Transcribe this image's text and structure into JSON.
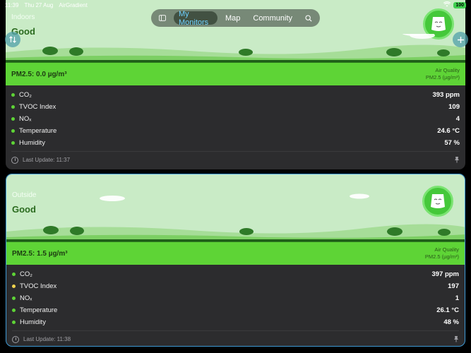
{
  "status": {
    "time": "11:39",
    "date": "Thu 27 Aug",
    "app": "AirGradient",
    "battery": "100"
  },
  "nav": {
    "items": [
      {
        "label": "My Monitors",
        "active": true
      },
      {
        "label": "Map"
      },
      {
        "label": "Community"
      }
    ]
  },
  "cards": [
    {
      "location": "Indoors",
      "quality": "Good",
      "pm": "PM2.5: 0.0 µg/m³",
      "aq_title": "Air Quality",
      "aq_unit": "PM2.5 (µg/m³)",
      "metrics": [
        {
          "name": "CO₂",
          "value": "393 ppm",
          "status": "green"
        },
        {
          "name": "TVOC Index",
          "value": "109",
          "status": "green"
        },
        {
          "name": "NOₓ",
          "value": "4",
          "status": "green"
        },
        {
          "name": "Temperature",
          "value": "24.6 °C",
          "status": "green"
        },
        {
          "name": "Humidity",
          "value": "57 %",
          "status": "green"
        }
      ],
      "last_update": "Last Update: 11:37"
    },
    {
      "location": "Outside",
      "quality": "Good",
      "pm": "PM2.5: 1.5 µg/m³",
      "aq_title": "Air Quality",
      "aq_unit": "PM2.5 (µg/m³)",
      "metrics": [
        {
          "name": "CO₂",
          "value": "397 ppm",
          "status": "green"
        },
        {
          "name": "TVOC Index",
          "value": "197",
          "status": "yellow"
        },
        {
          "name": "NOₓ",
          "value": "1",
          "status": "green"
        },
        {
          "name": "Temperature",
          "value": "26.1 °C",
          "status": "green"
        },
        {
          "name": "Humidity",
          "value": "48 %",
          "status": "green"
        }
      ],
      "last_update": "Last Update: 11:38"
    }
  ],
  "colors": {
    "good_green": "#5ed436",
    "card_bg": "#2c2c2e",
    "sky": "#c9ebc6",
    "selected_border": "#3f9bd6",
    "nav_active_text": "#6fd1ff",
    "warning_yellow": "#f2d44e"
  },
  "icons": {
    "sidebar_toggle": "sidebar-icon",
    "search": "search-icon",
    "sort": "sort-arrows-icon",
    "add": "plus-icon",
    "clock": "clock-icon",
    "pin": "pin-icon",
    "wifi": "wifi-icon",
    "mascot": "smiling-face-icon"
  }
}
